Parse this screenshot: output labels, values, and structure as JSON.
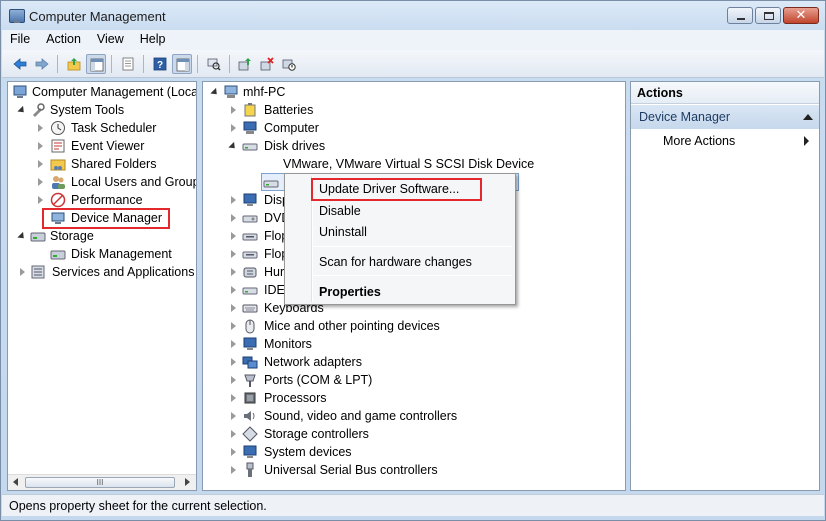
{
  "window": {
    "title": "Computer Management"
  },
  "menu": [
    "File",
    "Action",
    "View",
    "Help"
  ],
  "left_tree": {
    "root": "Computer Management (Local",
    "system_tools": "System Tools",
    "task_scheduler": "Task Scheduler",
    "event_viewer": "Event Viewer",
    "shared_folders": "Shared Folders",
    "local_users": "Local Users and Groups",
    "performance": "Performance",
    "device_manager": "Device Manager",
    "storage": "Storage",
    "disk_management": "Disk Management",
    "services": "Services and Applications"
  },
  "device_tree": {
    "root": "mhf-PC",
    "batteries": "Batteries",
    "computer": "Computer",
    "disk_drives": "Disk drives",
    "disk_device": "VMware, VMware Virtual S SCSI Disk Device",
    "display_partial": "Disp",
    "dvd_partial": "DVD",
    "floppy1_partial": "Flop",
    "floppy2_partial": "Flop",
    "hid_partial": "Hur",
    "ide_partial": "IDE",
    "keyboards": "Keyboards",
    "mice": "Mice and other pointing devices",
    "monitors": "Monitors",
    "network": "Network adapters",
    "ports": "Ports (COM & LPT)",
    "processors": "Processors",
    "sound": "Sound, video and game controllers",
    "storage_ctrl": "Storage controllers",
    "system_devices": "System devices",
    "usb": "Universal Serial Bus controllers"
  },
  "context_menu": {
    "update": "Update Driver Software...",
    "disable": "Disable",
    "uninstall": "Uninstall",
    "scan": "Scan for hardware changes",
    "properties": "Properties"
  },
  "actions": {
    "title": "Actions",
    "section": "Device Manager",
    "more": "More Actions"
  },
  "scrollbar": {
    "thumb_glyph": "III"
  },
  "status": "Opens property sheet for the current selection.",
  "colors": {
    "highlight_box": "#e3282e",
    "actions_section": "#c6d8ec"
  }
}
